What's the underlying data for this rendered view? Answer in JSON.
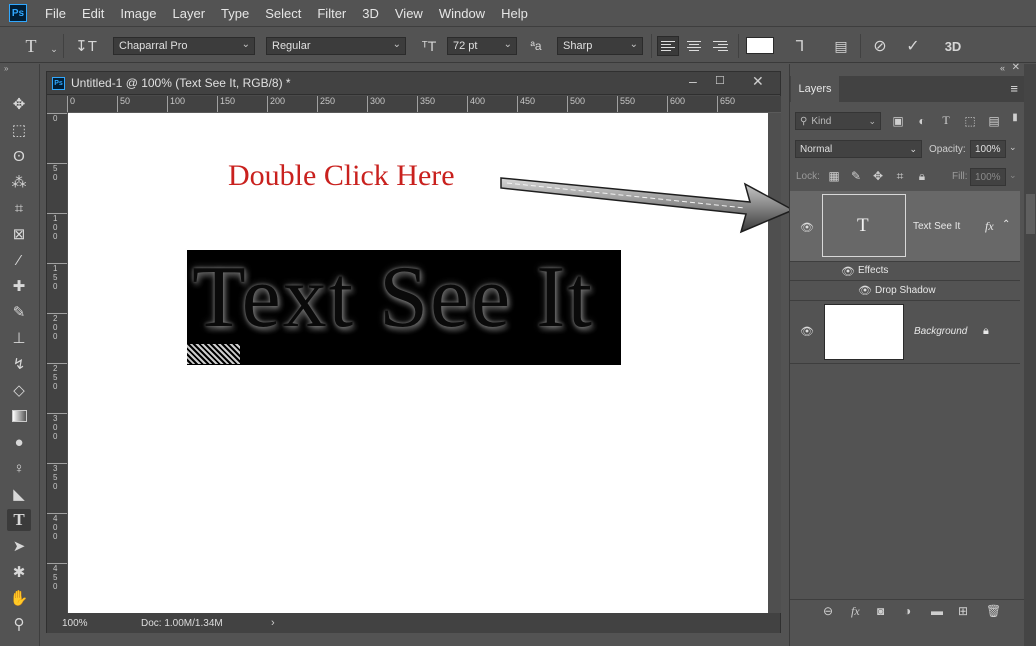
{
  "app": {
    "logo": "Ps"
  },
  "menu": [
    "File",
    "Edit",
    "Image",
    "Layer",
    "Type",
    "Select",
    "Filter",
    "3D",
    "View",
    "Window",
    "Help"
  ],
  "options_bar": {
    "tool_icon": "type-tool-icon",
    "orientation_icon": "text-orientation-icon",
    "font_family": "Chaparral Pro",
    "font_style": "Regular",
    "font_size_icon": "font-size-icon",
    "font_size": "72 pt",
    "antialias_icon": "antialias-icon",
    "antialias": "Sharp",
    "text_color": "#ffffff",
    "three_d": "3D"
  },
  "document": {
    "title": "Untitled-1 @ 100% (Text See It, RGB/8) *",
    "ruler_h": [
      "0",
      "50",
      "100",
      "150",
      "200",
      "250",
      "300",
      "350",
      "400",
      "450",
      "500",
      "550",
      "600",
      "650"
    ],
    "ruler_v": [
      "0",
      "5\n0",
      "1\n0\n0",
      "1\n5\n0",
      "2\n0\n0",
      "2\n5\n0",
      "3\n0\n0",
      "3\n5\n0",
      "4\n0\n0",
      "4\n5\n0"
    ],
    "annotation": "Double Click Here",
    "annotation_color": "#c9211e",
    "text_layer_content": "Text See It",
    "zoom": "100%",
    "doc_info": "Doc: 1.00M/1.34M"
  },
  "layers_panel": {
    "tab": "Layers",
    "filter_kind": "Kind",
    "blend_mode": "Normal",
    "opacity_label": "Opacity:",
    "opacity": "100%",
    "lock_label": "Lock:",
    "fill_label": "Fill:",
    "fill": "100%",
    "layers": [
      {
        "name": "Text See It",
        "thumb": "T",
        "fx": "fx",
        "effects_label": "Effects",
        "effect": "Drop Shadow"
      },
      {
        "name": "Background"
      }
    ]
  }
}
